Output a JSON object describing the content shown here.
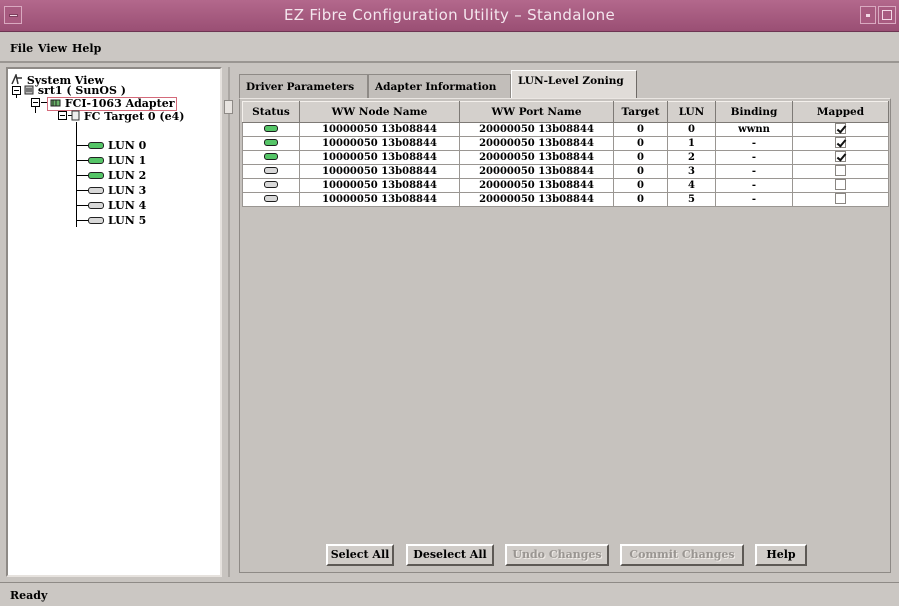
{
  "window": {
    "title": "EZ Fibre Configuration Utility – Standalone"
  },
  "colors": {
    "titlebar": "#9a4f74",
    "led_green": "#55c567",
    "led_gray": "#d8d8d8",
    "selection_border": "#d46a7a"
  },
  "menu": {
    "items": [
      {
        "label": "File"
      },
      {
        "label": "View"
      },
      {
        "label": "Help"
      }
    ]
  },
  "tree": {
    "root": "System View",
    "host": "srt1 ( SunOS )",
    "adapter": "FCI-1063 Adapter",
    "target": "FC Target 0 (e4)",
    "luns": [
      {
        "label": "LUN 0",
        "state": "green"
      },
      {
        "label": "LUN 1",
        "state": "green"
      },
      {
        "label": "LUN 2",
        "state": "green"
      },
      {
        "label": "LUN 3",
        "state": "gray"
      },
      {
        "label": "LUN 4",
        "state": "gray"
      },
      {
        "label": "LUN 5",
        "state": "gray"
      }
    ]
  },
  "tabs": [
    {
      "label": "Driver Parameters",
      "active": false
    },
    {
      "label": "Adapter Information",
      "active": false
    },
    {
      "label": "LUN-Level Zoning",
      "active": true
    }
  ],
  "grid": {
    "columns": [
      "Status",
      "WW Node Name",
      "WW Port Name",
      "Target",
      "LUN",
      "Binding",
      "Mapped"
    ],
    "rows": [
      {
        "status": "green",
        "node": "10000050 13b08844",
        "port": "20000050 13b08844",
        "target": "0",
        "lun": "0",
        "binding": "wwnn",
        "mapped": true
      },
      {
        "status": "green",
        "node": "10000050 13b08844",
        "port": "20000050 13b08844",
        "target": "0",
        "lun": "1",
        "binding": "-",
        "mapped": true
      },
      {
        "status": "green",
        "node": "10000050 13b08844",
        "port": "20000050 13b08844",
        "target": "0",
        "lun": "2",
        "binding": "-",
        "mapped": true
      },
      {
        "status": "gray",
        "node": "10000050 13b08844",
        "port": "20000050 13b08844",
        "target": "0",
        "lun": "3",
        "binding": "-",
        "mapped": false
      },
      {
        "status": "gray",
        "node": "10000050 13b08844",
        "port": "20000050 13b08844",
        "target": "0",
        "lun": "4",
        "binding": "-",
        "mapped": false
      },
      {
        "status": "gray",
        "node": "10000050 13b08844",
        "port": "20000050 13b08844",
        "target": "0",
        "lun": "5",
        "binding": "-",
        "mapped": false
      }
    ]
  },
  "buttons": {
    "select_all": "Select All",
    "deselect_all": "Deselect All",
    "undo_changes": "Undo Changes",
    "commit_changes": "Commit Changes",
    "help": "Help"
  },
  "status": {
    "text": "Ready"
  }
}
